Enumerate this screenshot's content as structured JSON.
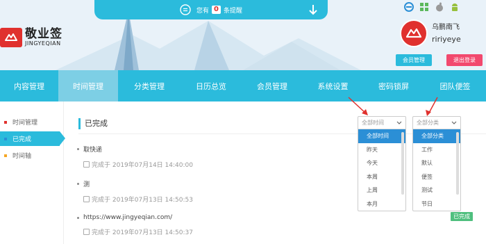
{
  "notice": {
    "prefix": "您有",
    "count": "0",
    "suffix": "条提醒"
  },
  "logo": {
    "name": "敬业签",
    "subtitle": "JINGYEQIAN"
  },
  "platform_icons": [
    "ie-icon",
    "windows-icon",
    "apple-icon",
    "android-icon"
  ],
  "user": {
    "name": "乌鹏南飞",
    "id": "ririyeye"
  },
  "buttons": {
    "member": "会员管理",
    "logout": "退出登录"
  },
  "nav": {
    "items": [
      {
        "label": "内容管理",
        "active": false
      },
      {
        "label": "时间管理",
        "active": true
      },
      {
        "label": "分类管理",
        "active": false
      },
      {
        "label": "日历总览",
        "active": false
      },
      {
        "label": "会员管理",
        "active": false
      },
      {
        "label": "系统设置",
        "active": false
      },
      {
        "label": "密码锁屏",
        "active": false
      },
      {
        "label": "团队便签",
        "active": false
      }
    ]
  },
  "sidebar": {
    "items": [
      {
        "label": "时间管理",
        "dot_color": "#e0312e",
        "active": false
      },
      {
        "label": "已完成",
        "dot_color": "#2b8fd6",
        "active": true
      },
      {
        "label": "时间轴",
        "dot_color": "#f5a623",
        "active": false
      }
    ]
  },
  "main": {
    "title": "已完成",
    "entries": [
      {
        "title": "取快递",
        "completed": "完成于 2019年07月14日 14:40:00"
      },
      {
        "title": "测",
        "completed": "完成于 2019年07月13日 14:50:53"
      },
      {
        "title": "https://www.jingyeqian.com/",
        "completed": "完成于 2019年07月13日 14:50:37"
      }
    ],
    "badge": "已完成"
  },
  "time_filter": {
    "selected": "全部时间",
    "options": [
      "全部时间",
      "昨天",
      "今天",
      "本周",
      "上周",
      "本月"
    ],
    "active_option": "全部时间"
  },
  "category_filter": {
    "selected": "全部分类",
    "options": [
      "全部分类",
      "工作",
      "默认",
      "便签",
      "测试",
      "节日"
    ],
    "active_option": "全部分类"
  },
  "colors": {
    "accent": "#2bbbdc",
    "brand_red": "#e0312e",
    "logout_pink": "#f2496e",
    "option_blue": "#2b8fd6",
    "badge_green": "#4fbf7e"
  }
}
